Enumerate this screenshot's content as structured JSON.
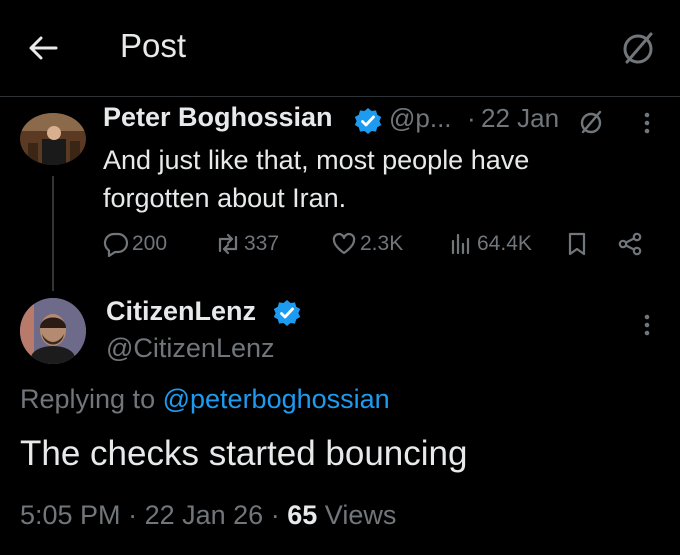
{
  "header": {
    "title": "Post",
    "back_icon": "arrow-left-icon",
    "grok_icon": "grok-icon"
  },
  "colors": {
    "background": "#000000",
    "text": "#e7e9ea",
    "muted": "#71767b",
    "accent": "#1d9bf0",
    "divider": "#2f3336"
  },
  "parent_tweet": {
    "author_name": "Peter Boghossian",
    "handle": "@p...",
    "separator": "·",
    "date": "22 Jan",
    "text": "And just like that, most people have forgotten about Iran.",
    "stats": {
      "replies": "200",
      "reposts": "337",
      "likes": "2.3K",
      "views": "64.4K"
    }
  },
  "reply_tweet": {
    "author_name": "CitizenLenz",
    "handle": "@CitizenLenz",
    "replying_prefix": "Replying to",
    "replying_to": "@peterboghossian",
    "text": "The checks started bouncing",
    "time": "5:05 PM",
    "sep1": "·",
    "date": "22 Jan 26",
    "sep2": "·",
    "views_count": "65",
    "views_label": "Views"
  }
}
